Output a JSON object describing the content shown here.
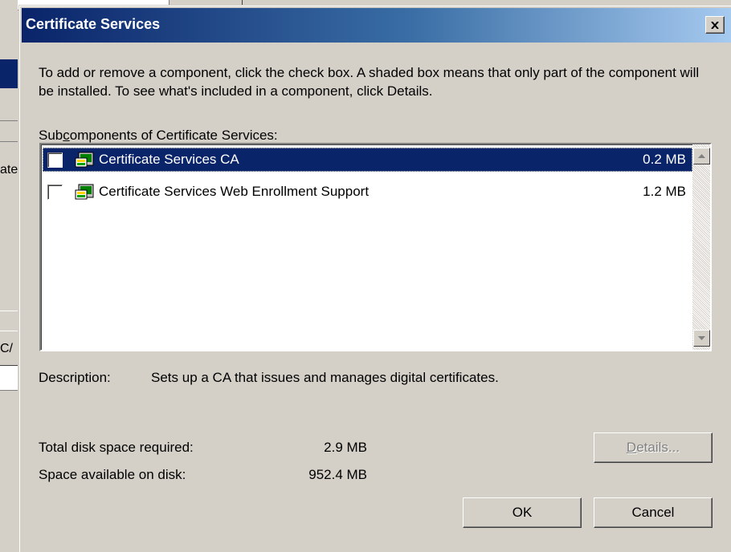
{
  "background": {
    "fragment_1": "ate",
    "fragment_2": "C/"
  },
  "dialog": {
    "title": "Certificate Services",
    "close_icon": "close-icon",
    "intro": "To add or remove a component, click the check box. A shaded box means that only part of the component will be installed. To see what's included in a component, click Details.",
    "subcomponents_label_pre": "Sub",
    "subcomponents_label_underlined": "c",
    "subcomponents_label_post": "omponents of Certificate Services:",
    "components": [
      {
        "label": "Certificate Services CA",
        "size": "0.2 MB",
        "checked": false,
        "selected": true
      },
      {
        "label": "Certificate Services Web Enrollment Support",
        "size": "1.2 MB",
        "checked": false,
        "selected": false
      }
    ],
    "description_label": "Description:",
    "description_text": "Sets up a CA that issues and manages digital certificates.",
    "total_space_label": "Total disk space required:",
    "total_space_value": "2.9 MB",
    "available_space_label": "Space available on disk:",
    "available_space_value": "952.4 MB",
    "buttons": {
      "details_underlined": "D",
      "details_rest": "etails...",
      "ok": "OK",
      "cancel": "Cancel"
    }
  },
  "colors": {
    "selection": "#0a246a",
    "face": "#d4d0c8"
  }
}
